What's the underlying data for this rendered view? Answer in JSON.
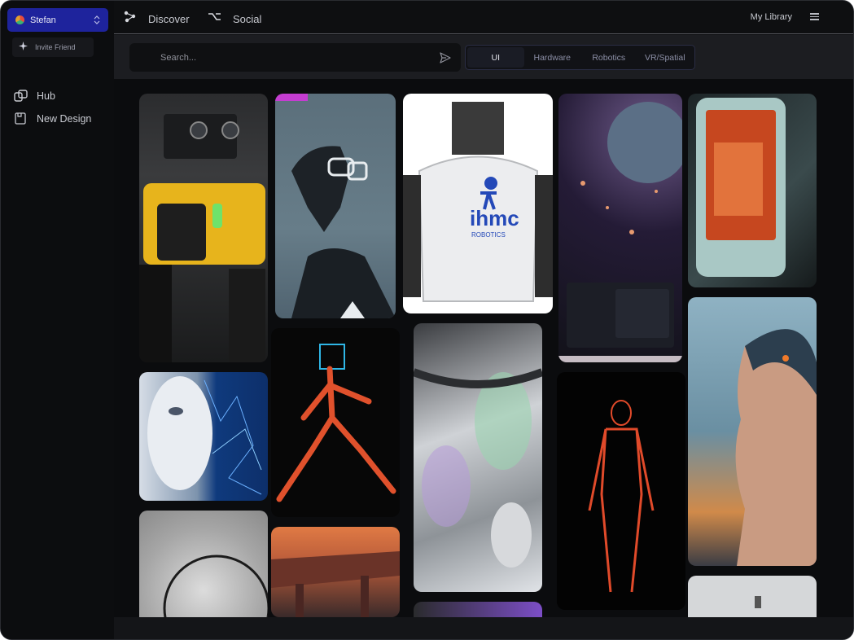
{
  "sidebar": {
    "user_name": "Stefan",
    "invite_label": "Invite Friend",
    "nav": [
      {
        "label": "Hub",
        "icon": "hub-icon"
      },
      {
        "label": "New Design",
        "icon": "new-design-icon"
      }
    ]
  },
  "topbar": {
    "discover_label": "Discover",
    "social_label": "Social",
    "library_label": "My Library"
  },
  "search": {
    "placeholder": "Search..."
  },
  "tabs": [
    {
      "label": "UI",
      "active": true
    },
    {
      "label": "Hardware",
      "active": false
    },
    {
      "label": "Robotics",
      "active": false
    },
    {
      "label": "VR/Spatial",
      "active": false
    }
  ],
  "colors": {
    "accent": "#1e239c",
    "background": "#0e0f11",
    "panel": "#1c1d21"
  },
  "feed": {
    "cards": [
      {
        "subject": "yellow quadruped robot dog"
      },
      {
        "subject": "cyborg head with glasses"
      },
      {
        "subject": "white humanoid robot torso",
        "logo_text": "ihmc",
        "logo_sub": "ROBOTICS"
      },
      {
        "subject": "planet network UI dashboard"
      },
      {
        "subject": "orange handheld device screen"
      },
      {
        "subject": "android face with blue circuitry"
      },
      {
        "subject": "red skeletal running figure"
      },
      {
        "subject": "iridescent robotic machinery"
      },
      {
        "subject": "red wireframe human figure"
      },
      {
        "subject": "woman with cybernetic head"
      },
      {
        "subject": "glowing circular light"
      },
      {
        "subject": "orange city overpass"
      },
      {
        "subject": "purple gradient card"
      },
      {
        "subject": "white wall fixture"
      }
    ]
  }
}
